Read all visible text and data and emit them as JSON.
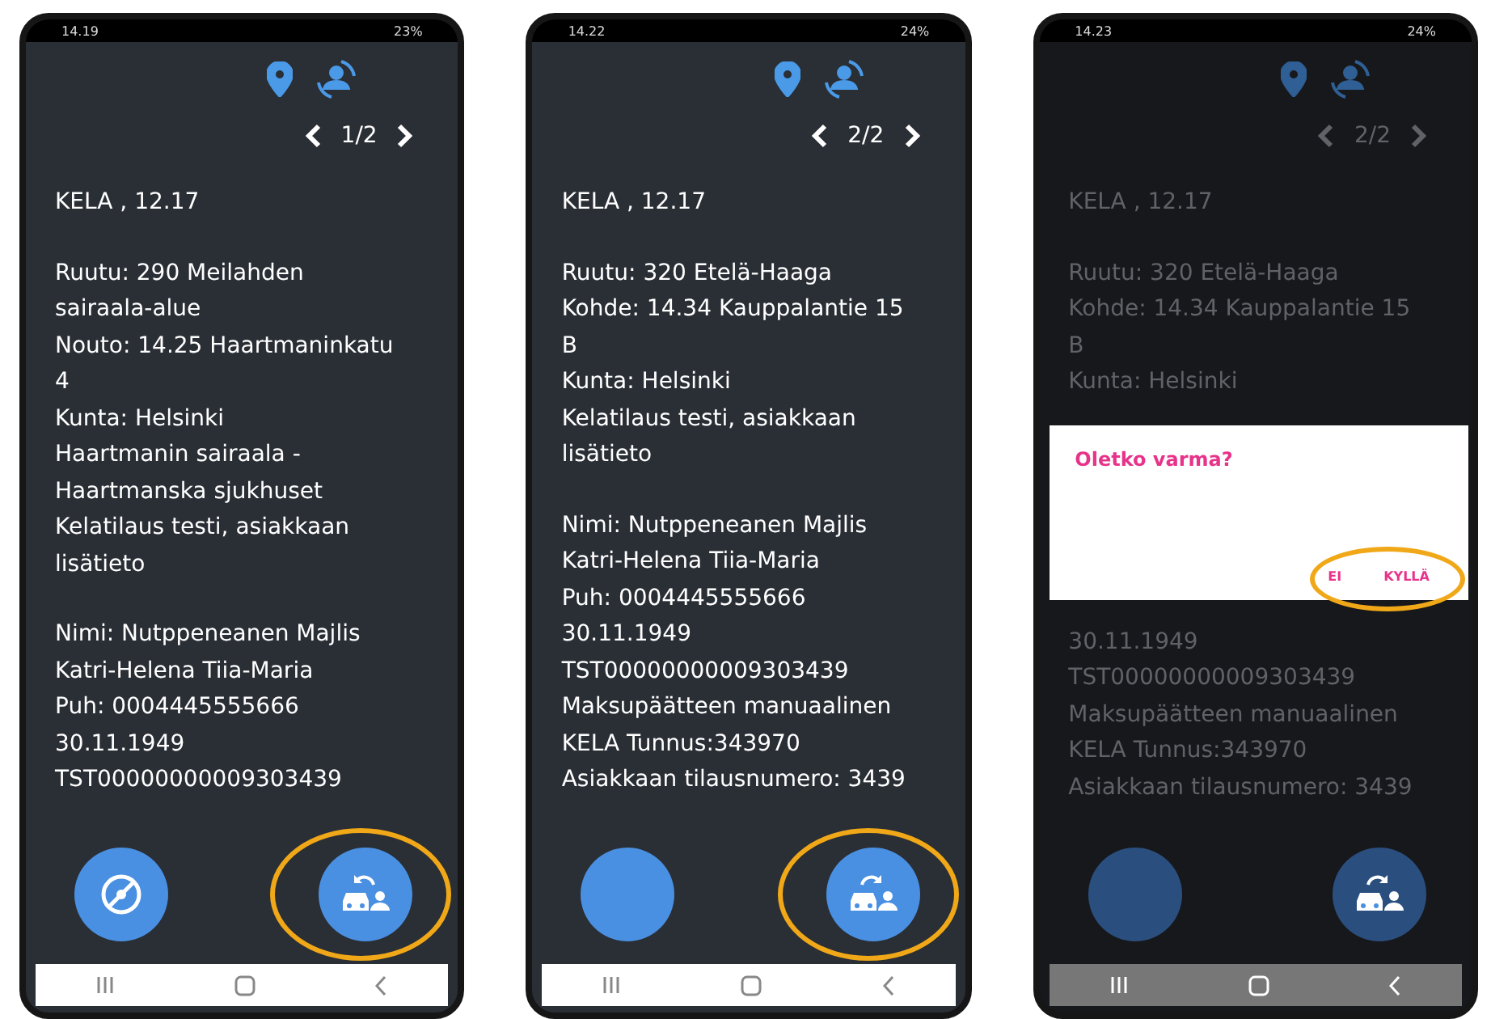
{
  "phones": [
    {
      "status": {
        "time": "14.19",
        "battery": "23%"
      },
      "pager": {
        "label": "1/2"
      },
      "dimmed": false,
      "blocks": [
        {
          "kind": "text",
          "lines": [
            "KELA , 12.17"
          ]
        },
        {
          "kind": "text",
          "lines": [
            "Ruutu: 290 Meilahden",
            "sairaala-alue",
            "Nouto: 14.25 Haartmaninkatu",
            "4",
            "Kunta: Helsinki",
            "Haartmanin sairaala -",
            "Haartmanska sjukhuset",
            "Kelatilaus testi, asiakkaan",
            "lisätieto"
          ]
        },
        {
          "kind": "text",
          "lines": [
            "Nimi: Nutppeneanen Majlis",
            "Katri-Helena Tiia-Maria",
            "Puh: 0004445555666",
            "30.11.1949",
            "TST00000000009303439"
          ]
        }
      ],
      "left_button": {
        "kind": "icon"
      },
      "right_button": {
        "kind": "return",
        "highlighted": true
      }
    },
    {
      "status": {
        "time": "14.22",
        "battery": "24%"
      },
      "pager": {
        "label": "2/2"
      },
      "dimmed": false,
      "blocks": [
        {
          "kind": "text",
          "lines": [
            "KELA , 12.17"
          ]
        },
        {
          "kind": "text",
          "lines": [
            "Ruutu: 320 Etelä-Haaga",
            "Kohde: 14.34 Kauppalantie 15",
            "B",
            "Kunta: Helsinki",
            "Kelatilaus testi, asiakkaan",
            "lisätieto"
          ]
        },
        {
          "kind": "text",
          "lines": [
            "Nimi: Nutppeneanen Majlis",
            "Katri-Helena Tiia-Maria",
            "Puh: 0004445555666",
            "30.11.1949",
            "TST00000000009303439",
            "Maksupäätteen manuaalinen",
            "KELA Tunnus:343970",
            "Asiakkaan tilausnumero: 3439"
          ]
        }
      ],
      "left_button": {
        "kind": "blank"
      },
      "right_button": {
        "kind": "forward",
        "highlighted": true
      }
    },
    {
      "status": {
        "time": "14.23",
        "battery": "24%"
      },
      "pager": {
        "label": "2/2"
      },
      "dimmed": true,
      "blocks": [
        {
          "kind": "text",
          "lines": [
            "KELA , 12.17"
          ]
        },
        {
          "kind": "text",
          "lines": [
            "Ruutu: 320 Etelä-Haaga",
            "Kohde: 14.34 Kauppalantie 15",
            "B",
            "Kunta: Helsinki"
          ]
        },
        {
          "kind": "dialog",
          "title": "Oletko varma?",
          "actions": [
            {
              "label": "EI"
            },
            {
              "label": "KYLLÄ"
            }
          ],
          "highlighted": true
        },
        {
          "kind": "text",
          "lines": [
            "30.11.1949",
            "TST00000000009303439",
            "Maksupäätteen manuaalinen",
            "KELA Tunnus:343970",
            "Asiakkaan tilausnumero: 3439"
          ]
        }
      ],
      "left_button": {
        "kind": "blank"
      },
      "right_button": {
        "kind": "forward",
        "highlighted": false
      }
    }
  ]
}
